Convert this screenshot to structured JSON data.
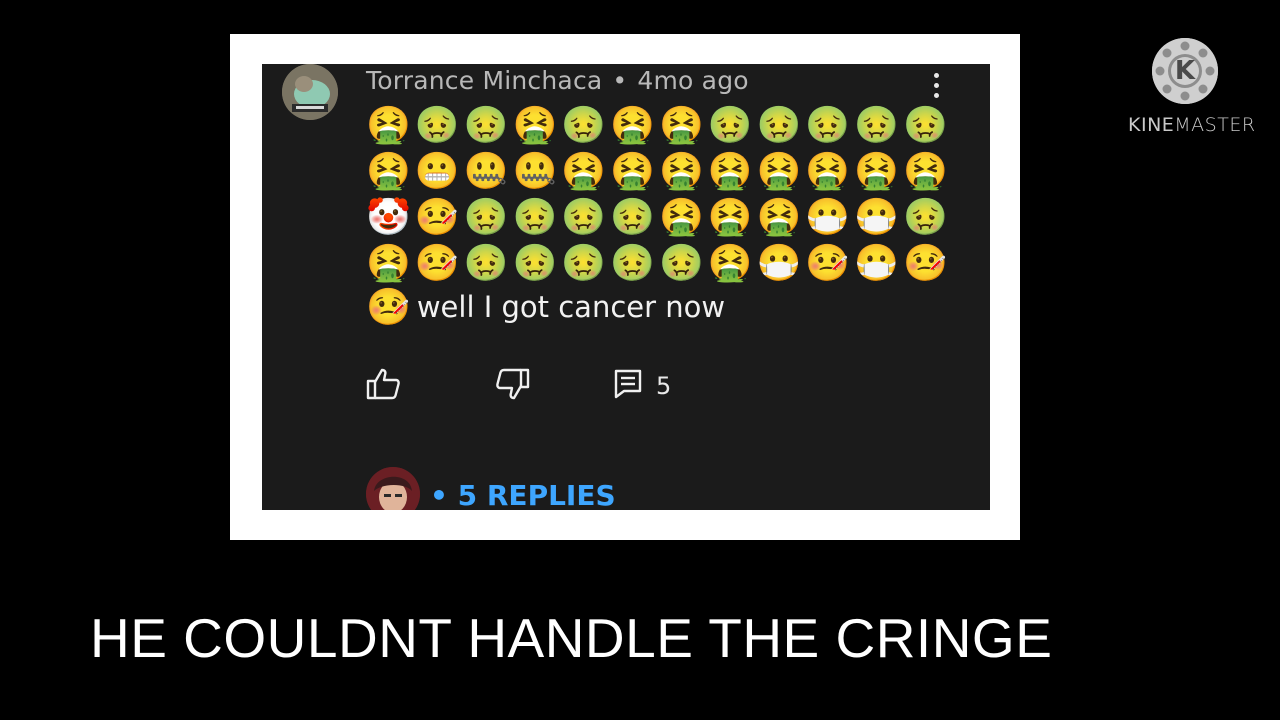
{
  "comment": {
    "author": "Torrance Minchaca",
    "separator": "•",
    "time": "4mo ago",
    "emoji_rows": [
      "🤮🤢🤢🤮🤢🤮🤮🤢🤢🤢🤢🤢",
      "🤮😬🤐🤐🤮🤮🤮🤮🤮🤮🤮🤮",
      "🤡🤒🤢🤢🤢🤢🤮🤮🤮😷😷🤢",
      "🤮🤒🤢🤢🤢🤢🤢🤮😷🤒😷🤒"
    ],
    "lead_emoji": "🤒",
    "text": "well I got cancer now",
    "like_icon": "thumbs-up-icon",
    "dislike_icon": "thumbs-down-icon",
    "reply_icon": "comment-icon",
    "reply_count": "5",
    "replies_link": "• 5 REPLIES"
  },
  "watermark": {
    "brand": "KINEMASTER",
    "brand_part1": "KINE",
    "brand_part2": "MASTER",
    "logo_letter": "K"
  },
  "caption": "HE COULDNT HANDLE THE CRINGE",
  "colors": {
    "background": "#000000",
    "card": "#1b1b1b",
    "frame": "#ffffff",
    "link": "#3ea6ff"
  }
}
